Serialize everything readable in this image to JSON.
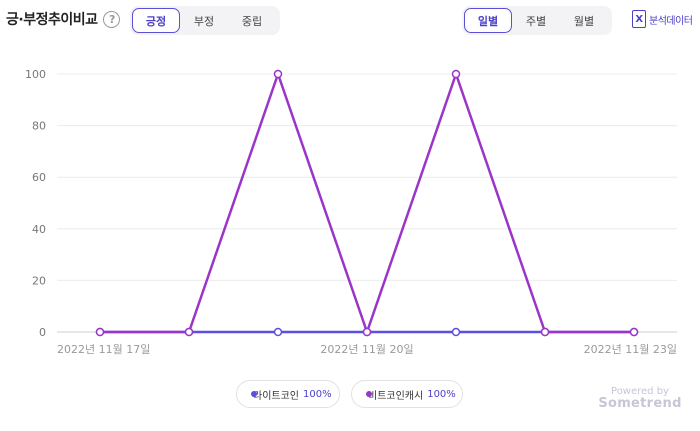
{
  "header": {
    "title": "긍·부정추이비교",
    "help_glyph": "?",
    "sentiment_tabs": [
      "긍정",
      "부정",
      "중립"
    ],
    "sentiment_active": 0,
    "period_tabs": [
      "일별",
      "주별",
      "월별"
    ],
    "period_active": 0,
    "export_label": "분석데이터",
    "export_icon": "X"
  },
  "legend": [
    {
      "name": "라이트코인",
      "percent": "100%",
      "color": "#5b4fe0"
    },
    {
      "name": "비트코인캐시",
      "percent": "100%",
      "color": "#9b35c9"
    }
  ],
  "powered": {
    "line1": "Powered by",
    "line2": "Sometrend"
  },
  "chart_data": {
    "type": "line",
    "x": [
      "2022-11-17",
      "2022-11-18",
      "2022-11-19",
      "2022-11-20",
      "2022-11-21",
      "2022-11-22",
      "2022-11-23"
    ],
    "x_tick_labels": [
      "2022년 11월 17일",
      "2022년 11월 20일",
      "2022년 11월 23일"
    ],
    "x_tick_indices": [
      0,
      3,
      6
    ],
    "y_ticks": [
      "0",
      "20",
      "40",
      "60",
      "80",
      "100"
    ],
    "ylim": [
      0,
      100
    ],
    "grid": true,
    "legend_position": "bottom",
    "series": [
      {
        "name": "라이트코인",
        "color": "#5b4fe0",
        "values": [
          0,
          0,
          0,
          0,
          0,
          0,
          0
        ]
      },
      {
        "name": "비트코인캐시",
        "color": "#9b35c9",
        "values": [
          0,
          0,
          100,
          0,
          100,
          0,
          0
        ]
      }
    ]
  }
}
